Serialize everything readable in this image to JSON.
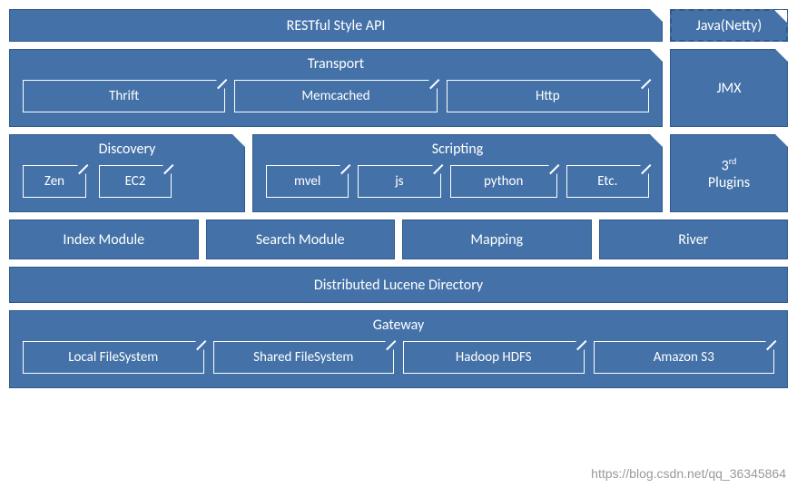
{
  "colors": {
    "block_bg": "#4472a8",
    "block_border": "#2f5a8a",
    "text": "#ffffff"
  },
  "row1": {
    "restful": "RESTful Style API",
    "java": "Java(Netty)"
  },
  "transport": {
    "title": "Transport",
    "items": [
      "Thrift",
      "Memcached",
      "Http"
    ]
  },
  "jmx": "JMX",
  "discovery": {
    "title": "Discovery",
    "items": [
      "Zen",
      "EC2"
    ]
  },
  "scripting": {
    "title": "Scripting",
    "items": [
      "mvel",
      "js",
      "python",
      "Etc."
    ]
  },
  "plugins_prefix": "3",
  "plugins_sup": "rd",
  "plugins_line2": "Plugins",
  "modules": {
    "index": "Index Module",
    "search": "Search Module",
    "mapping": "Mapping",
    "river": "River"
  },
  "lucene": "Distributed Lucene Directory",
  "gateway": {
    "title": "Gateway",
    "items": [
      "Local FileSystem",
      "Shared FileSystem",
      "Hadoop HDFS",
      "Amazon S3"
    ]
  },
  "watermark": "https://blog.csdn.net/qq_36345864"
}
